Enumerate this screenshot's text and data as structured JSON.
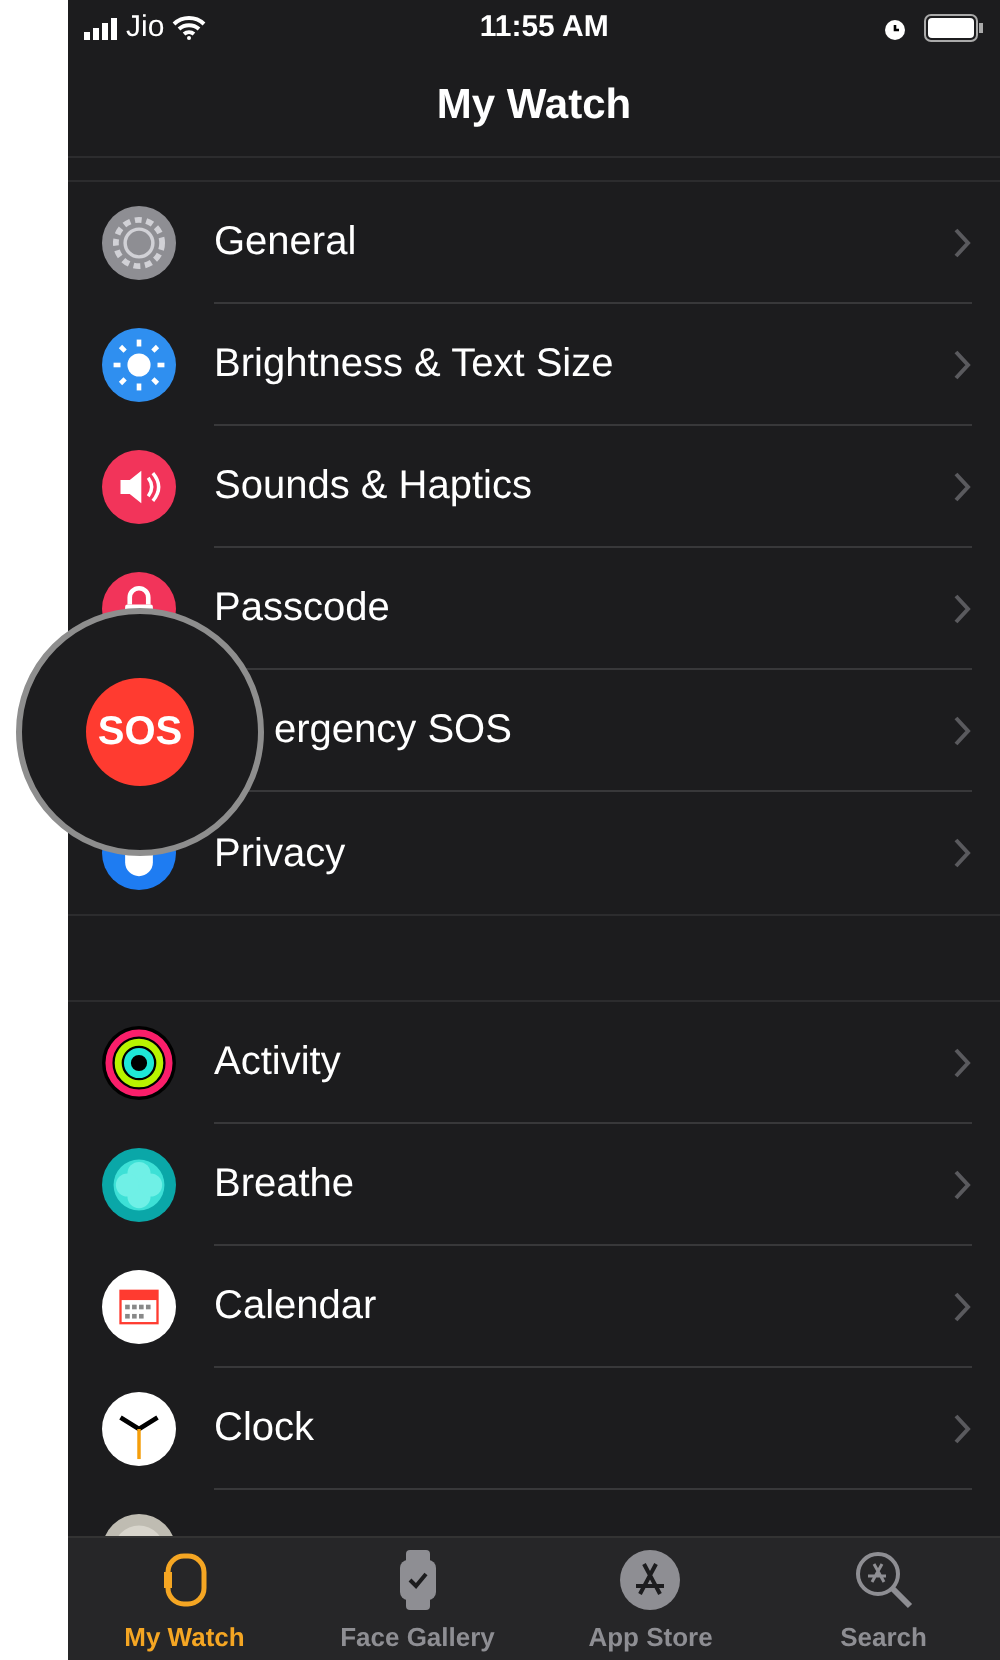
{
  "status_bar": {
    "carrier": "Jio",
    "time": "11:55 AM"
  },
  "title": "My Watch",
  "groups": [
    {
      "items": [
        {
          "label": "General"
        },
        {
          "label": "Brightness & Text Size"
        },
        {
          "label": "Sounds & Haptics"
        },
        {
          "label": "Passcode"
        },
        {
          "label": "ergency SOS"
        },
        {
          "label": "Privacy"
        }
      ]
    },
    {
      "items": [
        {
          "label": "Activity"
        },
        {
          "label": "Breathe"
        },
        {
          "label": "Calendar"
        },
        {
          "label": "Clock"
        }
      ]
    }
  ],
  "magnifier": {
    "text": "SOS"
  },
  "tabs": [
    {
      "label": "My Watch",
      "selected": true
    },
    {
      "label": "Face Gallery",
      "selected": false
    },
    {
      "label": "App Store",
      "selected": false
    },
    {
      "label": "Search",
      "selected": false
    }
  ]
}
